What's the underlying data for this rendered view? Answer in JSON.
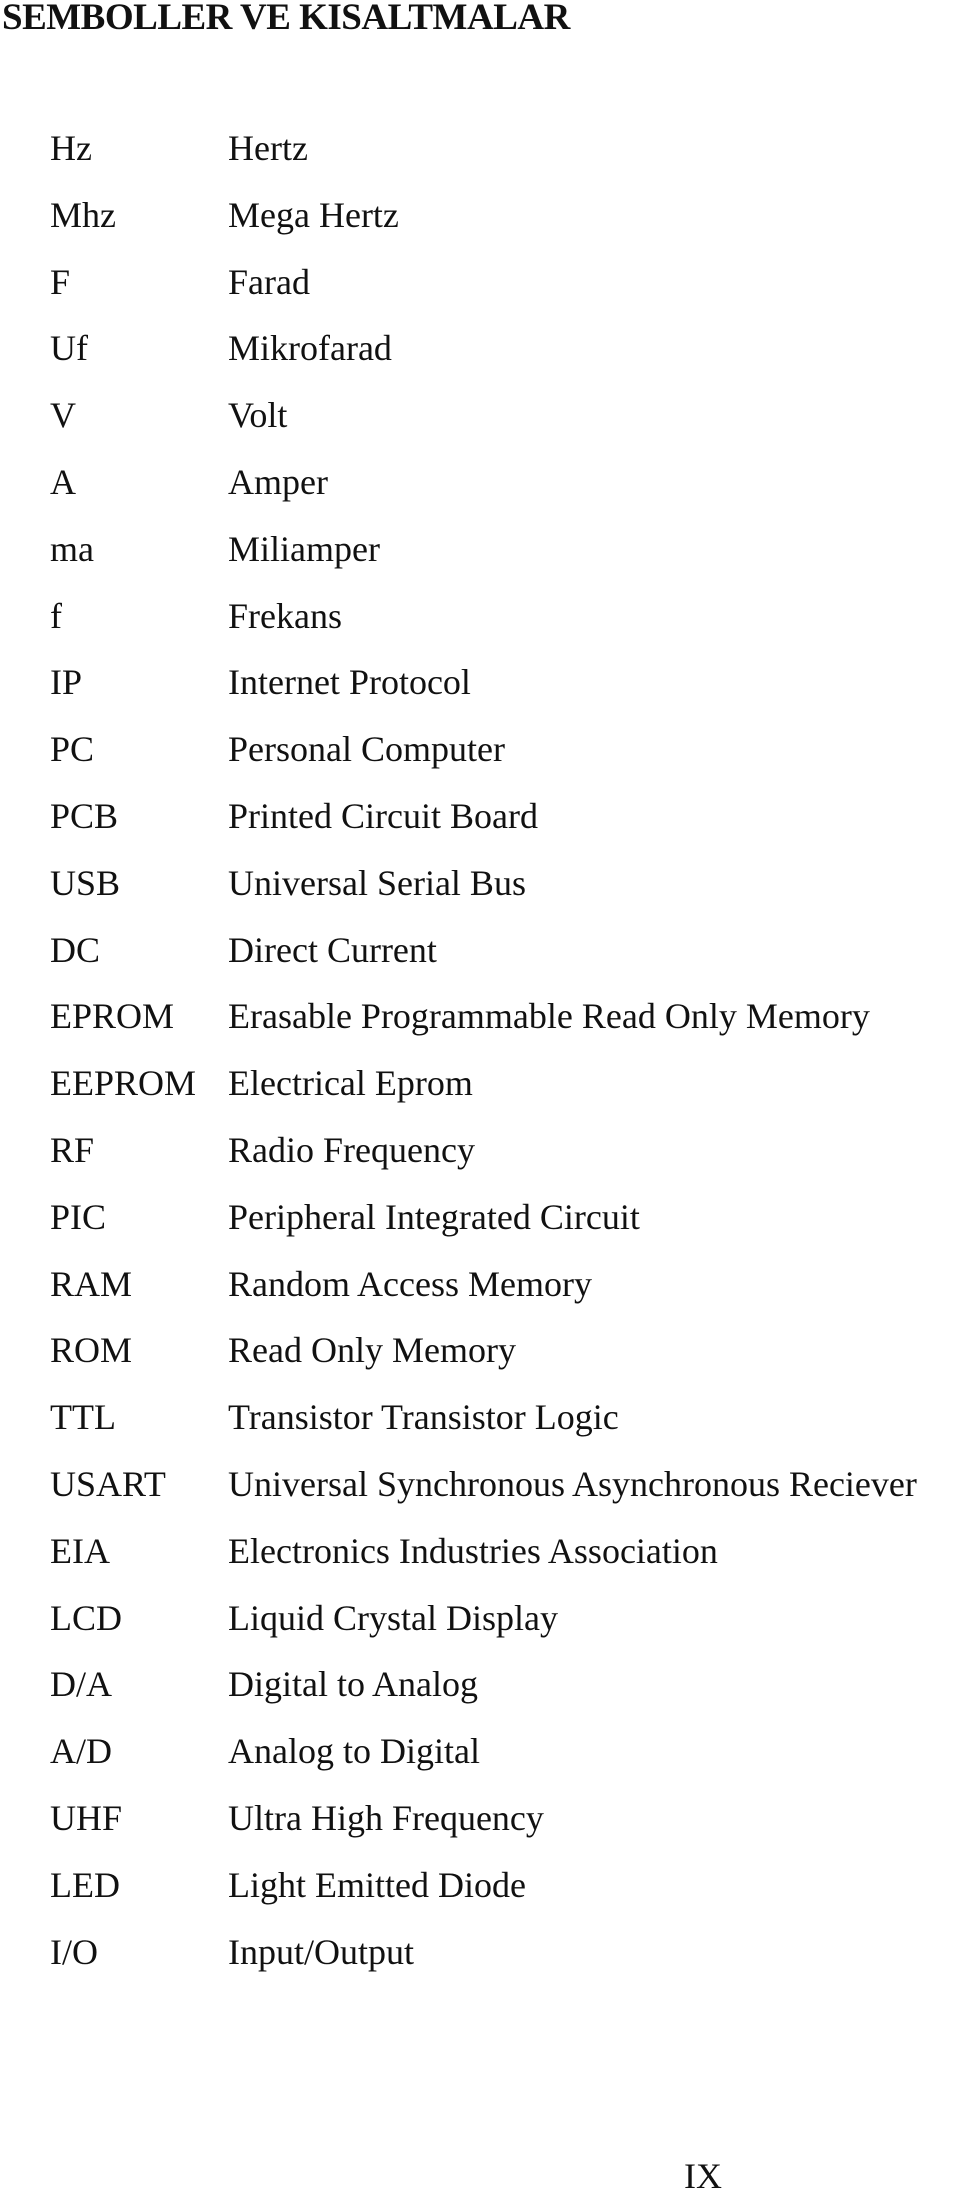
{
  "page": {
    "title": "SEMBOLLER VE KISALTMALAR",
    "page_number": "IX"
  },
  "entries": [
    {
      "symbol": "Hz",
      "meaning": "Hertz"
    },
    {
      "symbol": "Mhz",
      "meaning": "Mega Hertz"
    },
    {
      "symbol": "F",
      "meaning": "Farad"
    },
    {
      "symbol": "Uf",
      "meaning": "Mikrofarad"
    },
    {
      "symbol": "V",
      "meaning": "Volt"
    },
    {
      "symbol": "A",
      "meaning": "Amper"
    },
    {
      "symbol": "ma",
      "meaning": "Miliamper"
    },
    {
      "symbol": "f",
      "meaning": "Frekans"
    },
    {
      "symbol": "IP",
      "meaning": "Internet Protocol"
    },
    {
      "symbol": "PC",
      "meaning": "Personal Computer"
    },
    {
      "symbol": "PCB",
      "meaning": "Printed Circuit Board"
    },
    {
      "symbol": "USB",
      "meaning": "Universal Serial Bus"
    },
    {
      "symbol": "DC",
      "meaning": "Direct Current"
    },
    {
      "symbol": "EPROM",
      "meaning": "Erasable Programmable Read Only Memory"
    },
    {
      "symbol": "EEPROM",
      "meaning": "Electrical Eprom"
    },
    {
      "symbol": "RF",
      "meaning": "Radio Frequency"
    },
    {
      "symbol": "PIC",
      "meaning": "Peripheral Integrated Circuit"
    },
    {
      "symbol": "RAM",
      "meaning": "Random Access Memory"
    },
    {
      "symbol": "ROM",
      "meaning": "Read Only Memory"
    },
    {
      "symbol": "TTL",
      "meaning": "Transistor Transistor Logic"
    },
    {
      "symbol": "USART",
      "meaning": "Universal Synchronous Asynchronous Reciever"
    },
    {
      "symbol": "EIA",
      "meaning": "Electronics Industries Association"
    },
    {
      "symbol": "LCD",
      "meaning": "Liquid Crystal Display"
    },
    {
      "symbol": "D/A",
      "meaning": "Digital to Analog"
    },
    {
      "symbol": "A/D",
      "meaning": "Analog to Digital"
    },
    {
      "symbol": "UHF",
      "meaning": "Ultra High Frequency"
    },
    {
      "symbol": "LED",
      "meaning": "Light Emitted Diode"
    },
    {
      "symbol": "I/O",
      "meaning": "Input/Output"
    }
  ]
}
